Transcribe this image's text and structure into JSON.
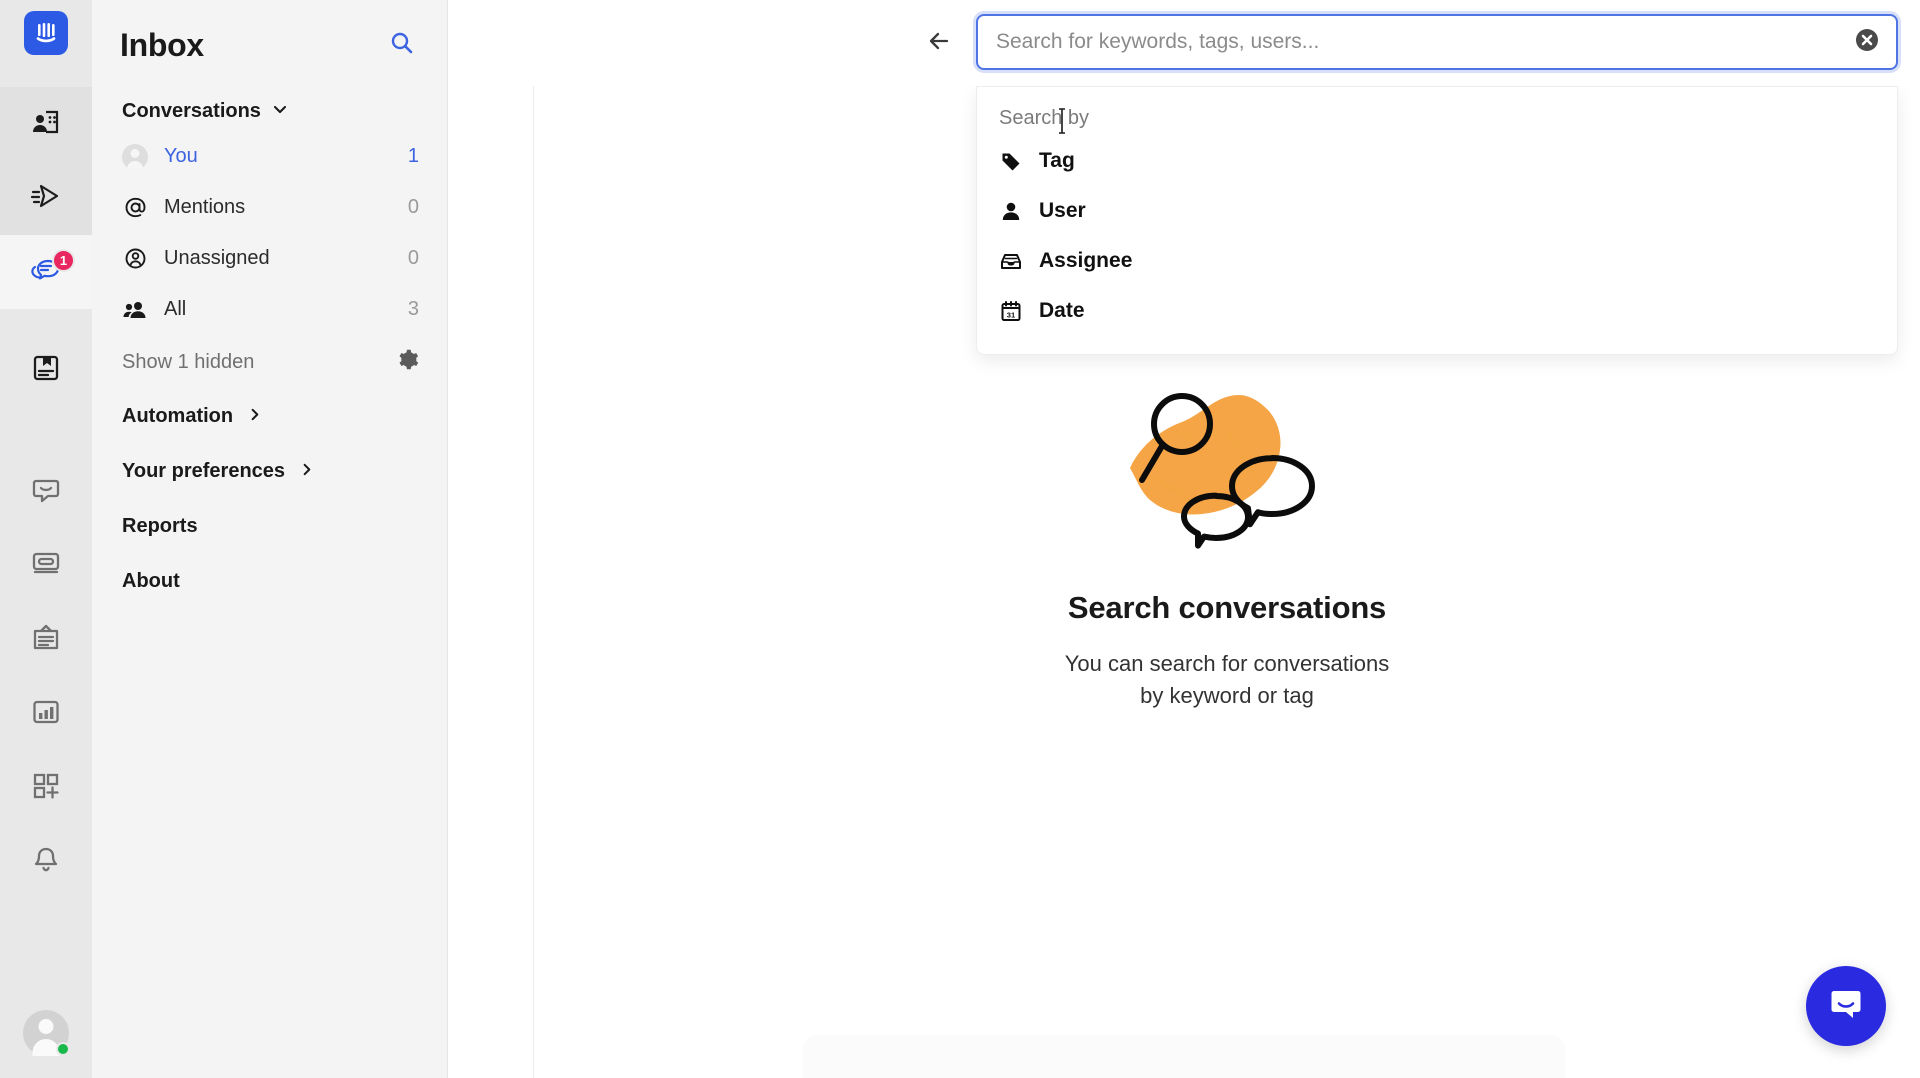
{
  "app": {
    "logo_icon": "intercom-logo-icon",
    "brand_color": "#2d5ae5"
  },
  "rail": {
    "items": [
      {
        "icon": "contacts-icon",
        "name": "contacts",
        "badge": null
      },
      {
        "icon": "outbound-send-icon",
        "name": "outbound",
        "badge": null
      },
      {
        "icon": "inbox-conversations-icon",
        "name": "inbox",
        "badge": "1"
      },
      {
        "icon": "articles-icon",
        "name": "articles",
        "badge": null
      },
      {
        "icon": "messenger-icon",
        "name": "messenger",
        "badge": null
      },
      {
        "icon": "tickets-icon",
        "name": "tickets",
        "badge": null
      },
      {
        "icon": "clipboard-icon",
        "name": "clipboard",
        "badge": null
      },
      {
        "icon": "reports-chart-icon",
        "name": "reports",
        "badge": null
      },
      {
        "icon": "apps-plus-icon",
        "name": "apps",
        "badge": null
      },
      {
        "icon": "bell-icon",
        "name": "notifications",
        "badge": null
      }
    ],
    "avatar": {
      "name": "user-avatar",
      "status": "online"
    }
  },
  "sidebar": {
    "title": "Inbox",
    "search_icon": "search-icon",
    "section": {
      "label": "Conversations",
      "chevron": "chevron-down-icon"
    },
    "items": [
      {
        "label": "You",
        "count": "1",
        "icon": "avatar-icon",
        "active": true
      },
      {
        "label": "Mentions",
        "count": "0",
        "icon": "at-sign-icon",
        "active": false
      },
      {
        "label": "Unassigned",
        "count": "0",
        "icon": "unassigned-person-icon",
        "active": false
      },
      {
        "label": "All",
        "count": "3",
        "icon": "people-icon",
        "active": false
      }
    ],
    "hidden_row": {
      "label": "Show 1 hidden",
      "gear_icon": "gear-icon"
    },
    "links": [
      {
        "label": "Automation",
        "chevron": "chevron-right-icon"
      },
      {
        "label": "Your preferences",
        "chevron": "chevron-right-icon"
      },
      {
        "label": "Reports",
        "chevron": null
      },
      {
        "label": "About",
        "chevron": null
      }
    ]
  },
  "topbar": {
    "back_icon": "arrow-left-icon",
    "search": {
      "value": "",
      "placeholder": "Search for keywords, tags, users...",
      "clear_icon": "clear-circle-icon",
      "focused": true
    }
  },
  "dropdown": {
    "heading": "Search by",
    "options": [
      {
        "label": "Tag",
        "icon": "tag-icon"
      },
      {
        "label": "User",
        "icon": "person-icon"
      },
      {
        "label": "Assignee",
        "icon": "inbox-tray-icon"
      },
      {
        "label": "Date",
        "icon": "calendar-31-icon"
      }
    ]
  },
  "empty_state": {
    "illustration": "magnifier-speech-bubbles-illustration",
    "title": "Search conversations",
    "subtitle_line1": "You can search for conversations",
    "subtitle_line2": "by keyword or tag"
  },
  "launcher": {
    "icon": "intercom-messenger-icon",
    "color": "#2a2ae0"
  }
}
